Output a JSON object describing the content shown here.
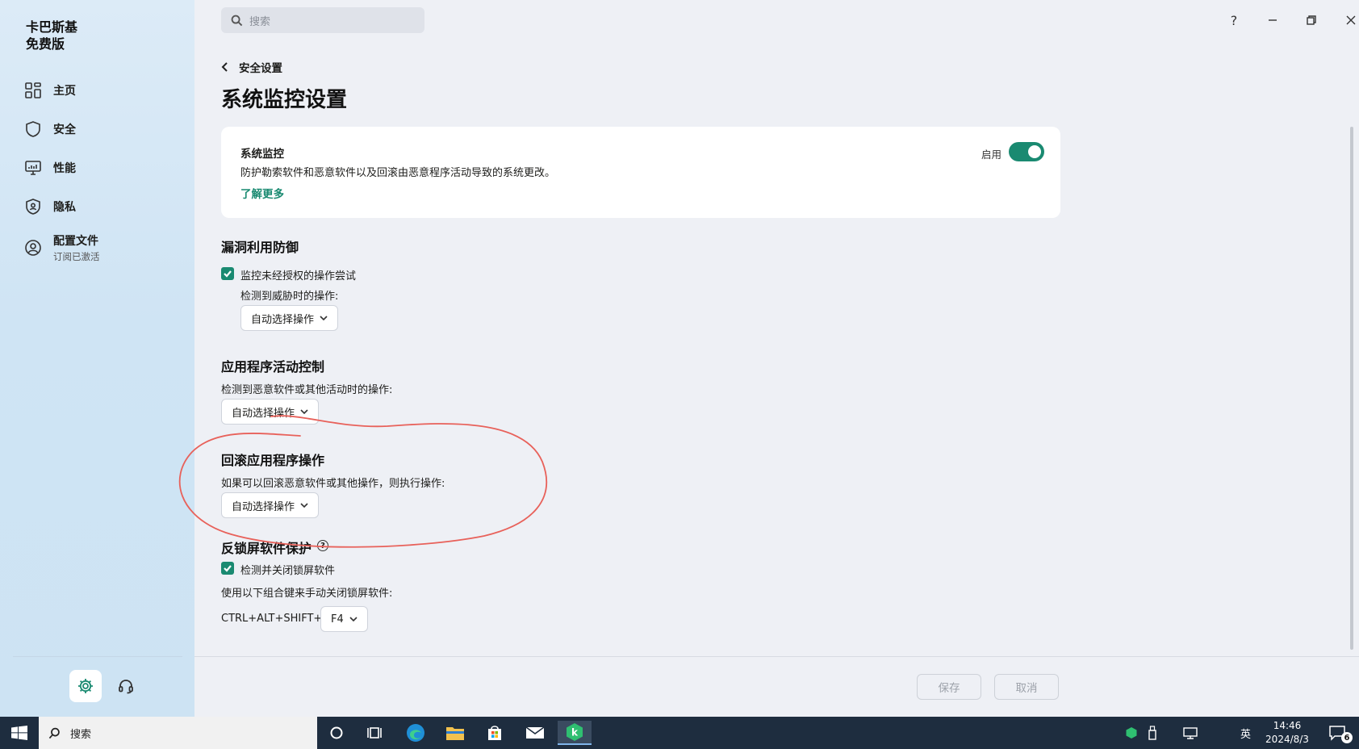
{
  "app": {
    "brand_line1": "卡巴斯基",
    "brand_line2": "免费版"
  },
  "sidebar": {
    "items": [
      {
        "label": "主页",
        "icon": "grid-icon"
      },
      {
        "label": "安全",
        "icon": "shield-icon"
      },
      {
        "label": "性能",
        "icon": "monitor-icon"
      },
      {
        "label": "隐私",
        "icon": "privacy-shield-icon"
      },
      {
        "label": "配置文件",
        "sub": "订阅已激活",
        "icon": "user-circle-icon"
      }
    ]
  },
  "search": {
    "placeholder": "搜索"
  },
  "window": {
    "help": "?"
  },
  "breadcrumb": {
    "back_label": "安全设置"
  },
  "page": {
    "title": "系统监控设置"
  },
  "monitor_card": {
    "title": "系统监控",
    "description": "防护勒索软件和恶意软件以及回滚由恶意程序活动导致的系统更改。",
    "link": "了解更多",
    "toggle_label": "启用",
    "toggle_on": true
  },
  "exploit": {
    "heading": "漏洞利用防御",
    "checkbox_label": "监控未经授权的操作尝试",
    "checked": true,
    "action_label": "检测到威胁时的操作:",
    "action_value": "自动选择操作"
  },
  "app_control": {
    "heading": "应用程序活动控制",
    "action_label": "检测到恶意软件或其他活动时的操作:",
    "action_value": "自动选择操作"
  },
  "rollback": {
    "heading": "回滚应用程序操作",
    "action_label": "如果可以回滚恶意软件或其他操作，则执行操作:",
    "action_value": "自动选择操作"
  },
  "anti_locker": {
    "heading": "反锁屏软件保护",
    "checkbox_label": "检测并关闭锁屏软件",
    "checked": true,
    "combo_label": "使用以下组合键来手动关闭锁屏软件:",
    "combo_prefix": "CTRL+ALT+SHIFT+",
    "combo_key": "F4"
  },
  "footer": {
    "save": "保存",
    "cancel": "取消"
  },
  "taskbar": {
    "search_text": "搜索",
    "ime": "英",
    "time": "14:46",
    "date": "2024/8/3",
    "notifications": "6"
  },
  "colors": {
    "accent": "#1a8a71",
    "annotation": "#e8615a",
    "taskbar": "#1e2d3f"
  }
}
